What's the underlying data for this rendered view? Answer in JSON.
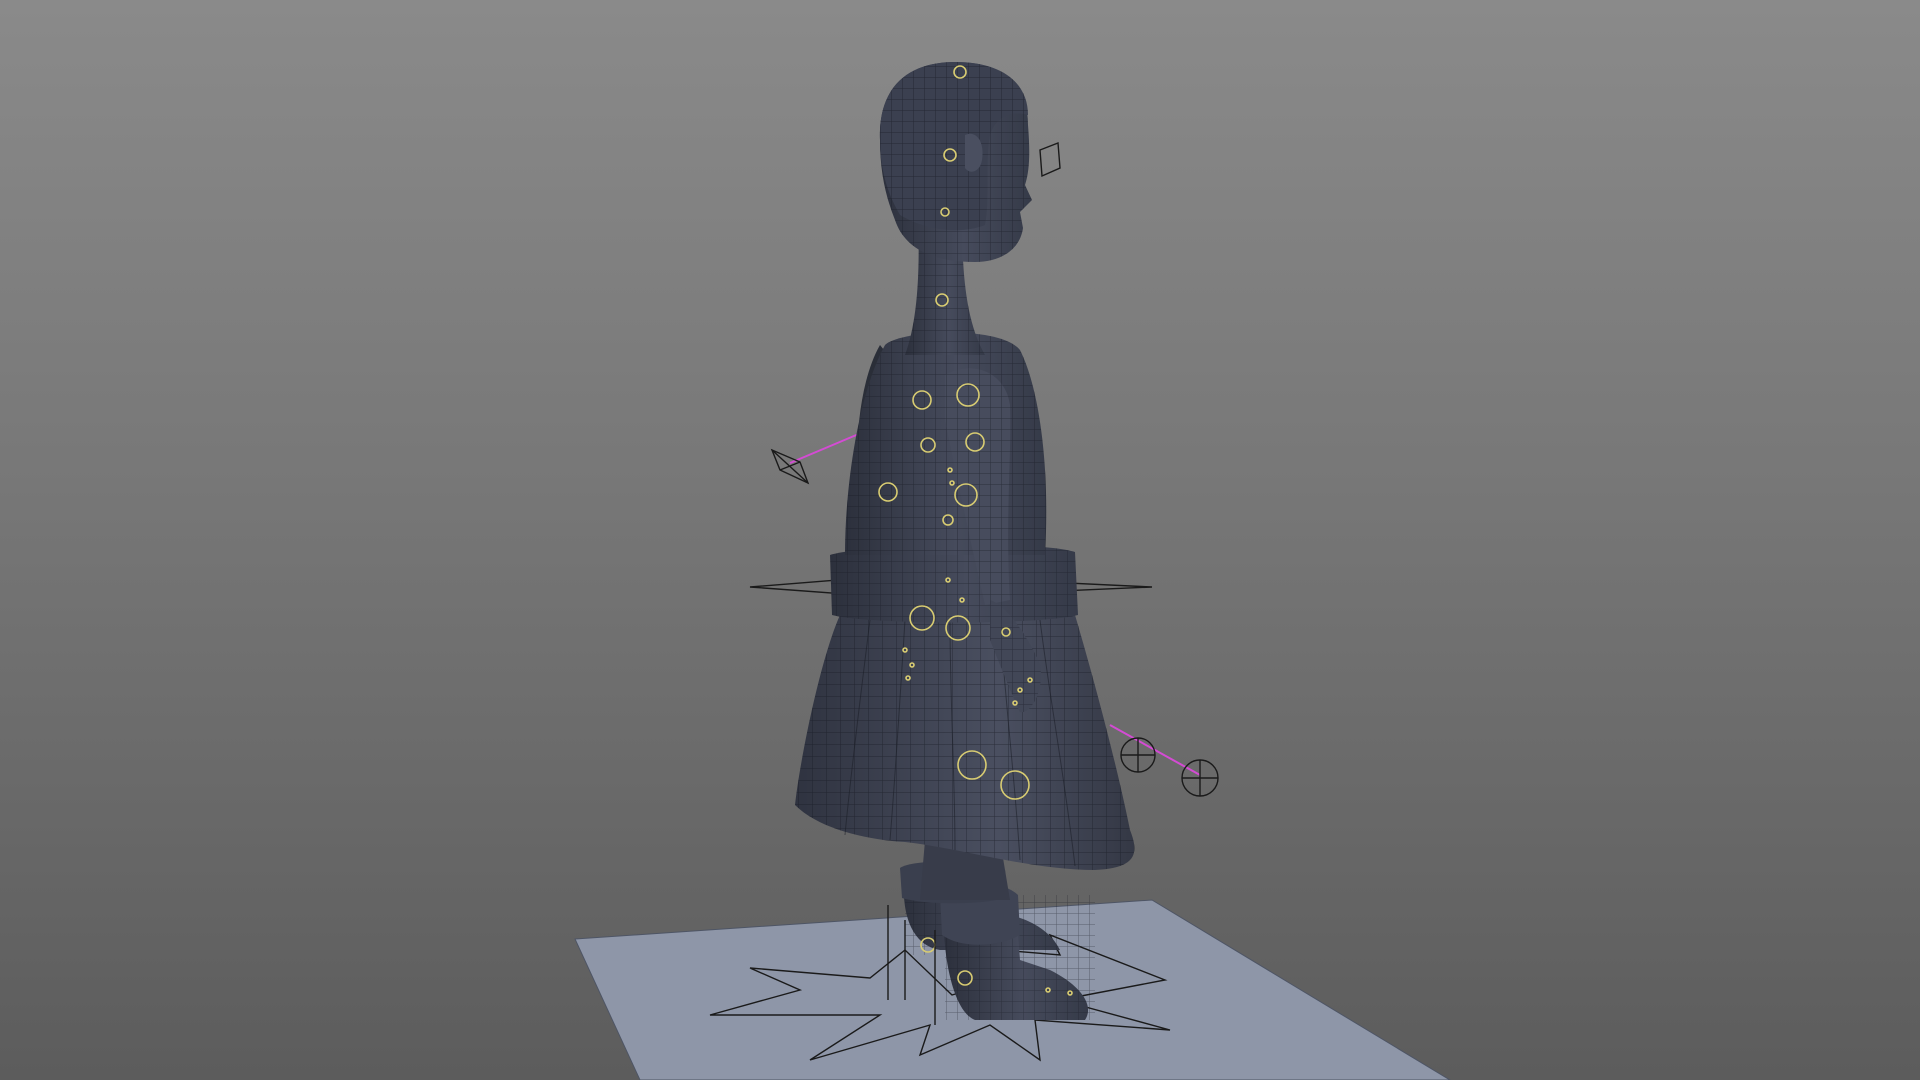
{
  "viewport": {
    "view": "perspective",
    "shading": "wireframe-on-shaded",
    "colors": {
      "background_top": "#8a8a8a",
      "background_bottom": "#5c5c5c",
      "mesh": "#3d4252",
      "mesh_wire": "#1a1d26",
      "ground_plane": "#8e96a8",
      "control_curve": "#d8cc72",
      "ik_handle": "#d44bd4"
    }
  },
  "scene": {
    "character": "rigged-girl-character-side-view",
    "parts": [
      "head",
      "hair",
      "neck",
      "torso",
      "arm",
      "hand",
      "belt",
      "skirt",
      "leg",
      "boot"
    ],
    "controls": [
      "head-control",
      "neck-control",
      "shoulder-controls",
      "elbow-control",
      "wrist-control",
      "hip-control",
      "knee-controls",
      "foot-controls",
      "pole-vector-locators",
      "root-star-control"
    ]
  }
}
